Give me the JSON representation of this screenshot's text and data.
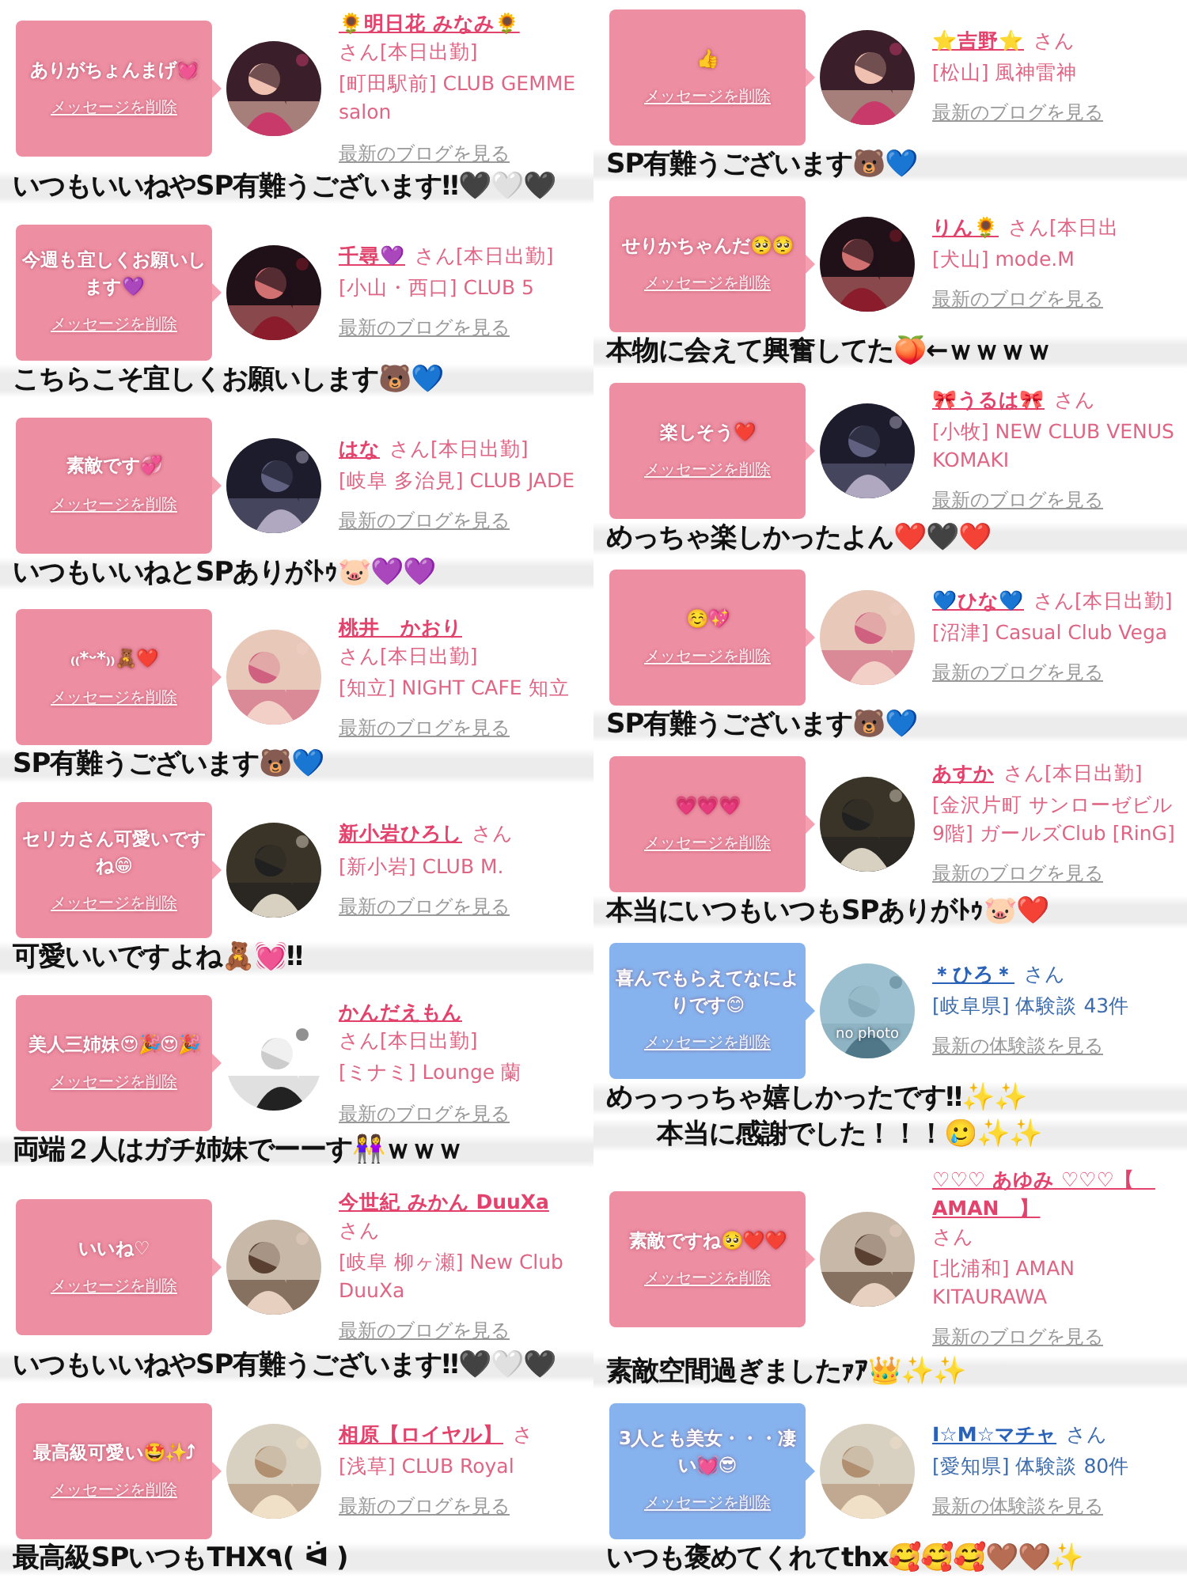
{
  "columns": [
    {
      "entries": [
        {
          "kind": "cast",
          "message": "ありがちょんまげ💓",
          "delete_link": "メッセージを削除",
          "name": "🌻明日花 みなみ🌻",
          "suffix": "さん[本日出勤]",
          "shop": "[町田駅前] CLUB GEMME salon",
          "blog_link": "最新のブログを見る",
          "caption": [
            "いつもいいねやSP有難うございます‼🖤🤍🖤"
          ]
        },
        {
          "kind": "cast",
          "message": "今週も宜しくお願いします💜",
          "delete_link": "メッセージを削除",
          "name": "千尋💜",
          "suffix": "さん[本日出勤]",
          "shop": "[小山・西口] CLUB 5",
          "blog_link": "最新のブログを見る",
          "caption": [
            "こちらこそ宜しくお願いします🐻💙"
          ]
        },
        {
          "kind": "cast",
          "message": "素敵です💞",
          "delete_link": "メッセージを削除",
          "name": "はな",
          "suffix": "さん[本日出勤]",
          "shop": "[岐阜 多治見] CLUB JADE",
          "blog_link": "最新のブログを見る",
          "caption": [
            "いつもいいねとSPありがﾄｩ🐷💜💜"
          ]
        },
        {
          "kind": "cast",
          "message": "₍₍*ᵕ*₎₎🧸❤️",
          "delete_link": "メッセージを削除",
          "name": "桃井　かおり",
          "suffix": "さん[本日出勤]",
          "shop": "[知立] NIGHT CAFE 知立",
          "blog_link": "最新のブログを見る",
          "caption": [
            "SP有難うございます🐻💙"
          ]
        },
        {
          "kind": "cast",
          "message": "セリカさん可愛いですね😁",
          "delete_link": "メッセージを削除",
          "name": "新小岩ひろし",
          "suffix": "さん",
          "shop": "[新小岩] CLUB M.",
          "blog_link": "最新のブログを見る",
          "caption": [
            "可愛いいですよね🧸💓‼"
          ]
        },
        {
          "kind": "cast",
          "message": "美人三姉妹😍🎉😍🎉",
          "delete_link": "メッセージを削除",
          "name": "かんだえもん",
          "suffix": "さん[本日出勤]",
          "shop": "[ミナミ] Lounge 蘭",
          "blog_link": "最新のブログを見る",
          "caption": [
            "両端２人はガチ姉妹でーーす👭ｗｗｗ"
          ]
        },
        {
          "kind": "cast",
          "message": "いいね♡",
          "delete_link": "メッセージを削除",
          "name": "今世紀 みかん DuuXa",
          "suffix": "さん",
          "shop": "[岐阜 柳ヶ瀬] New Club DuuXa",
          "blog_link": "最新のブログを見る",
          "caption": [
            "いつもいいねやSP有難うございます‼🖤🤍🖤"
          ]
        },
        {
          "kind": "cast",
          "message": "最高級可愛い🤩✨⤴",
          "delete_link": "メッセージを削除",
          "name": "相原【ロイヤル】",
          "suffix": "さ",
          "shop": "[浅草] CLUB Royal",
          "blog_link": "最新のブログを見る",
          "caption": [
            "最高級SPいつもTHX٩( ᐛ )"
          ]
        }
      ]
    },
    {
      "entries": [
        {
          "kind": "cast",
          "message": "👍",
          "delete_link": "メッセージを削除",
          "name": "⭐吉野⭐",
          "suffix": "さん",
          "shop": "[松山] 風神雷神",
          "blog_link": "最新のブログを見る",
          "caption": [
            "SP有難うございます🐻💙"
          ]
        },
        {
          "kind": "cast",
          "message": "せりかちゃんだ🥺🥺",
          "delete_link": "メッセージを削除",
          "name": "りん🌻",
          "suffix": "さん[本日出",
          "shop": "[犬山] mode.M",
          "blog_link": "最新のブログを見る",
          "caption": [
            "本物に会えて興奮してた🍑←ｗｗｗｗ"
          ]
        },
        {
          "kind": "cast",
          "message": "楽しそう❤️",
          "delete_link": "メッセージを削除",
          "name": "🎀うるは🎀",
          "suffix": "さん",
          "shop": "[小牧] NEW CLUB VENUS KOMAKI",
          "blog_link": "最新のブログを見る",
          "caption": [
            "めっちゃ楽しかったよん❤️🖤❤️"
          ]
        },
        {
          "kind": "cast",
          "message": "☺️💖",
          "delete_link": "メッセージを削除",
          "name": "💙ひな💙",
          "suffix": "さん[本日出勤]",
          "shop": "[沼津] Casual Club Vega",
          "blog_link": "最新のブログを見る",
          "caption": [
            "SP有難うございます🐻💙"
          ]
        },
        {
          "kind": "cast",
          "message": "💗💗💗",
          "delete_link": "メッセージを削除",
          "name": "あすか",
          "suffix": "さん[本日出勤]",
          "shop": "[金沢片町 サンローゼビル9階] ガールズClub [RinG]",
          "blog_link": "最新のブログを見る",
          "caption": [
            "本当にいつもいつもSPありがﾄｩ🐷❤️"
          ]
        },
        {
          "kind": "user",
          "message": "喜んでもらえてなによりです😊",
          "delete_link": "メッセージを削除",
          "name": "＊ひろ＊",
          "suffix": "さん",
          "shop": "[岐阜県] 体験談 43件",
          "blog_link": "最新の体験談を見る",
          "avatar_label": "no photo",
          "caption": [
            "めっっっちゃ嬉しかったです‼✨✨",
            "本当に感謝でした！！！🥲✨✨"
          ]
        },
        {
          "kind": "cast",
          "message": "素敵ですね🥺❤️❤️",
          "delete_link": "メッセージを削除",
          "name": "♡♡♡ あゆみ ♡♡♡【　AMAN　】",
          "suffix": "さん",
          "shop": "[北浦和] AMAN KITAURAWA",
          "blog_link": "最新のブログを見る",
          "caption": [
            "素敵空間過ぎましたｧｱ👑✨✨"
          ]
        },
        {
          "kind": "user",
          "message": "3人とも美女・・・凄い💓😎",
          "delete_link": "メッセージを削除",
          "name": "I☆M☆マチャ",
          "suffix": "さん",
          "shop": "[愛知県] 体験談 80件",
          "blog_link": "最新の体験談を見る",
          "caption": [
            "いつも褒めてくれてthx🥰🥰🥰🤎🤎✨"
          ]
        }
      ]
    }
  ]
}
